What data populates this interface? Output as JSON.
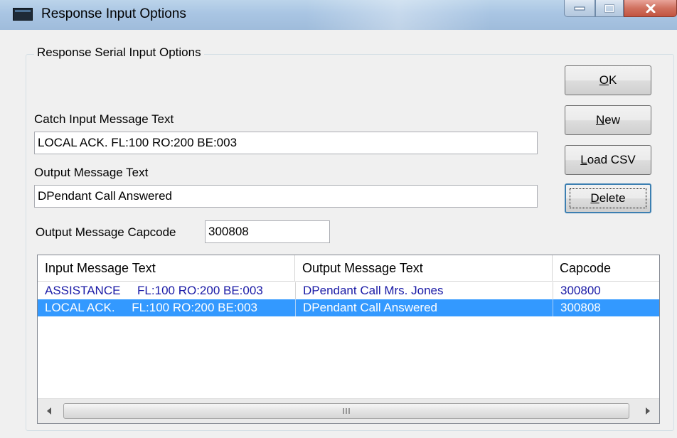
{
  "window": {
    "title": "Response Input Options"
  },
  "group": {
    "label": "Response Serial Input Options"
  },
  "fields": {
    "catch_label": "Catch Input Message Text",
    "catch_value": "LOCAL ACK.    FL:100 RO:200 BE:003",
    "output_label": "Output Message Text",
    "output_value": "DPendant Call Answered",
    "capcode_label": "Output Message Capcode",
    "capcode_value": "300808"
  },
  "buttons": {
    "ok": {
      "mnemonic": "O",
      "rest": "K"
    },
    "new": {
      "mnemonic": "N",
      "rest": "ew"
    },
    "load_csv": {
      "mnemonic": "L",
      "rest": "oad CSV"
    },
    "delete": {
      "mnemonic": "D",
      "rest": "elete"
    }
  },
  "table": {
    "columns": [
      "Input Message Text",
      "Output Message Text",
      "Capcode"
    ],
    "rows": [
      {
        "input": "ASSISTANCE     FL:100 RO:200 BE:003",
        "output": "DPendant Call Mrs. Jones",
        "capcode": "300800",
        "selected": false
      },
      {
        "input": "LOCAL ACK.     FL:100 RO:200 BE:003",
        "output": "DPendant Call Answered",
        "capcode": "300808",
        "selected": true
      }
    ]
  },
  "icons": {
    "app": "window-app-icon",
    "minimize": "minimize-icon",
    "maximize": "maximize-icon",
    "close": "close-icon",
    "scroll_left": "chevron-left-icon",
    "scroll_right": "chevron-right-icon",
    "scroll_grip": "scroll-grip-icon"
  },
  "colors": {
    "selection": "#3399ff",
    "row_text": "#1a1aa6",
    "close_button": "#c25440"
  }
}
